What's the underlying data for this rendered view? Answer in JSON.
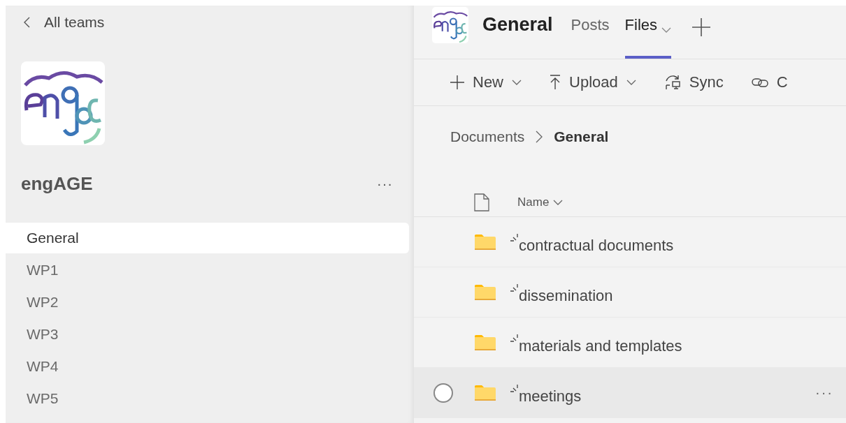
{
  "sidebar": {
    "back_link": "All teams",
    "team_name": "engAGE",
    "more": "···",
    "channels": [
      {
        "label": "General",
        "selected": true
      },
      {
        "label": "WP1",
        "selected": false
      },
      {
        "label": "WP2",
        "selected": false
      },
      {
        "label": "WP3",
        "selected": false
      },
      {
        "label": "WP4",
        "selected": false
      },
      {
        "label": "WP5",
        "selected": false
      }
    ]
  },
  "header": {
    "title": "General",
    "tabs": [
      {
        "label": "Posts",
        "selected": false,
        "has_menu": false
      },
      {
        "label": "Files",
        "selected": true,
        "has_menu": true
      }
    ]
  },
  "toolbar": [
    {
      "kind": "new",
      "label": "New",
      "has_menu": true
    },
    {
      "kind": "upload",
      "label": "Upload",
      "has_menu": true
    },
    {
      "kind": "sync",
      "label": "Sync",
      "has_menu": false
    },
    {
      "kind": "link",
      "label": "C",
      "has_menu": false
    }
  ],
  "breadcrumb": [
    {
      "label": "Documents",
      "current": false
    },
    {
      "label": "General",
      "current": true
    }
  ],
  "table": {
    "name_column": "Name",
    "rows": [
      {
        "name": "contractual documents",
        "hovered": false
      },
      {
        "name": "dissemination",
        "hovered": false
      },
      {
        "name": "materials and templates",
        "hovered": false
      },
      {
        "name": "meetings",
        "hovered": true,
        "more": "···"
      }
    ]
  }
}
